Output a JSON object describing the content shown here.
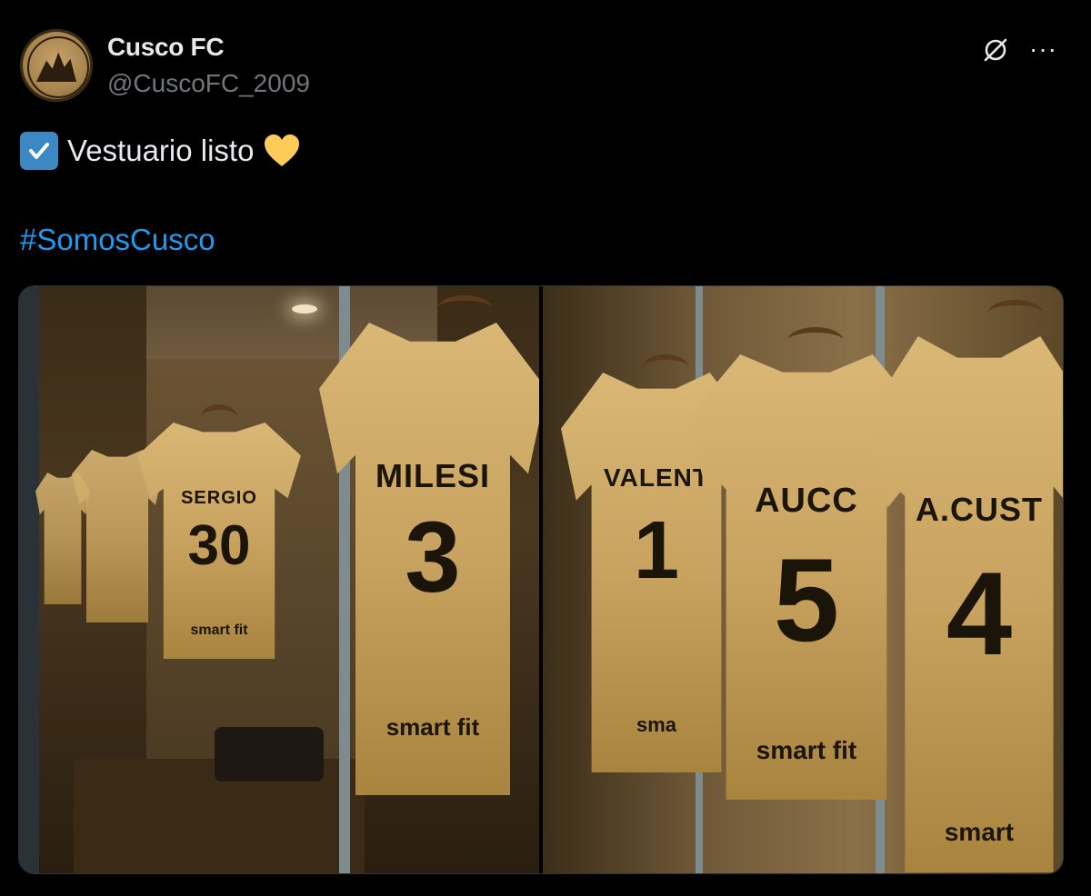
{
  "header": {
    "display_name": "Cusco FC",
    "handle": "@CuscoFC_2009",
    "avatar_icon": "club-crest-avatar",
    "grok_icon": "grok-icon",
    "more_label": "···"
  },
  "post": {
    "check_emoji": "check-box-emoji",
    "text": "Vestuario listo",
    "heart_emoji": "yellow-heart-emoji",
    "hashtag": "#SomosCusco"
  },
  "media": {
    "left": {
      "jerseys": [
        {
          "name": "",
          "number": "",
          "sponsor": ""
        },
        {
          "name": "",
          "number": "",
          "sponsor": ""
        },
        {
          "name": "SERGIO",
          "number": "30",
          "sponsor": "smart fit"
        },
        {
          "name": "MILESI",
          "number": "3",
          "sponsor": "smart fit"
        }
      ]
    },
    "right": {
      "jerseys": [
        {
          "name": "VALENT",
          "number": "1",
          "sponsor": "sma"
        },
        {
          "name": "AUCC",
          "number": "5",
          "sponsor": "smart fit"
        },
        {
          "name": "A.CUST",
          "number": "4",
          "sponsor": "smart"
        }
      ]
    },
    "colors": {
      "jersey": "#c8a25f",
      "accent_blue": "#1d9bf0"
    }
  }
}
